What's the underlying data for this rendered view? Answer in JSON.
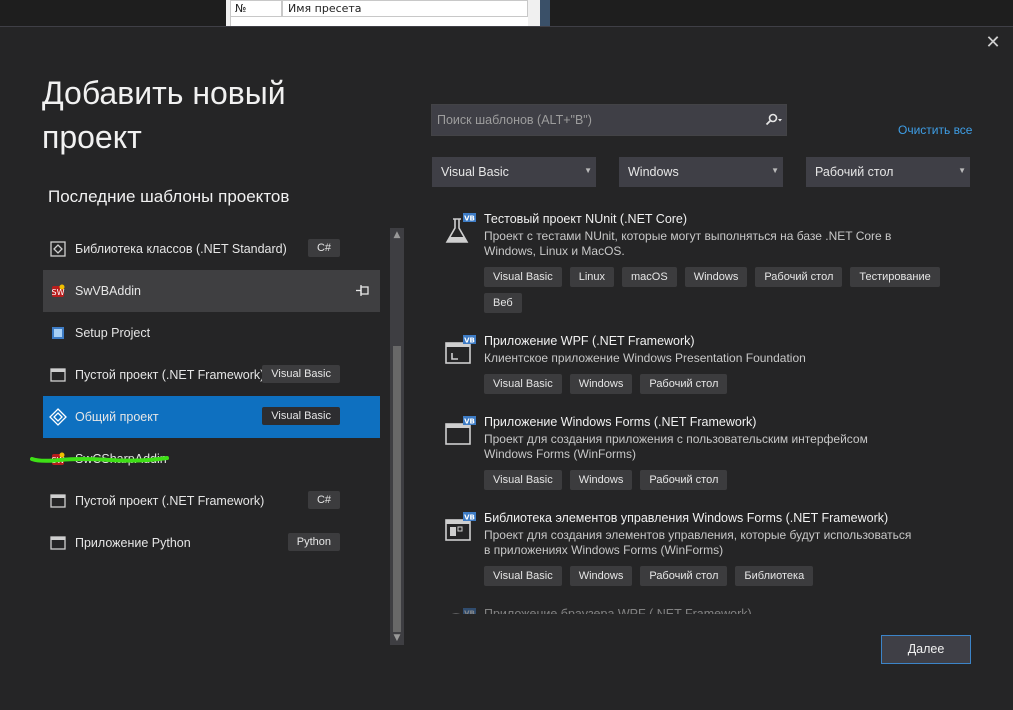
{
  "background_window": {
    "col_number": "№",
    "col_preset_name": "Имя пресета"
  },
  "dialog": {
    "title": "Добавить новый проект",
    "recent_heading": "Последние шаблоны проектов",
    "close_icon": "close-icon",
    "recent_templates": [
      {
        "label": "Библиотека классов (.NET Standard)",
        "lang": "C#",
        "icon": "class-library-icon",
        "state": "normal"
      },
      {
        "label": "SwVBAddin",
        "lang": "",
        "icon": "addin-icon",
        "state": "hover"
      },
      {
        "label": "Setup Project",
        "lang": "",
        "icon": "setup-project-icon",
        "state": "normal"
      },
      {
        "label": "Пустой проект (.NET Framework)",
        "lang": "Visual Basic",
        "icon": "empty-project-icon",
        "state": "normal"
      },
      {
        "label": "Общий проект",
        "lang": "Visual Basic",
        "icon": "shared-project-icon",
        "state": "selected"
      },
      {
        "label": "SwCSharpAddin",
        "lang": "",
        "icon": "addin-icon",
        "state": "normal"
      },
      {
        "label": "Пустой проект (.NET Framework)",
        "lang": "C#",
        "icon": "empty-project-icon",
        "state": "normal"
      },
      {
        "label": "Приложение Python",
        "lang": "Python",
        "icon": "python-app-icon",
        "state": "normal"
      }
    ],
    "search": {
      "placeholder": "Поиск шаблонов (ALT+\"В\")",
      "value": ""
    },
    "clear_all": "Очистить все",
    "filters": {
      "language": "Visual Basic",
      "platform": "Windows",
      "project_type": "Рабочий стол"
    },
    "templates": [
      {
        "title": "Тестовый проект NUnit (.NET Core)",
        "description": "Проект с тестами NUnit, которые могут выполняться на базе .NET Core в Windows, Linux и MacOS.",
        "tags": [
          "Visual Basic",
          "Linux",
          "macOS",
          "Windows",
          "Рабочий стол",
          "Тестирование",
          "Веб"
        ],
        "icon": "test-flask-icon"
      },
      {
        "title": "Приложение WPF (.NET Framework)",
        "description": "Клиентское приложение Windows Presentation Foundation",
        "tags": [
          "Visual Basic",
          "Windows",
          "Рабочий стол"
        ],
        "icon": "wpf-app-icon"
      },
      {
        "title": "Приложение Windows Forms (.NET Framework)",
        "description": "Проект для создания приложения с пользовательским интерфейсом Windows Forms (WinForms)",
        "tags": [
          "Visual Basic",
          "Windows",
          "Рабочий стол"
        ],
        "icon": "winforms-app-icon"
      },
      {
        "title": "Библиотека элементов управления Windows Forms (.NET Framework)",
        "description": "Проект для создания элементов управления, которые будут использоваться в приложениях Windows Forms (WinForms)",
        "tags": [
          "Visual Basic",
          "Windows",
          "Рабочий стол",
          "Библиотека"
        ],
        "icon": "control-library-icon"
      },
      {
        "title": "Приложение браузера WPF (.NET Framework)",
        "description": "",
        "tags": [],
        "icon": "wpf-browser-app-icon"
      }
    ],
    "next_button": "Далее"
  },
  "colors": {
    "background": "#252526",
    "selected": "#0e70c0",
    "accent_link": "#3e9ee6",
    "annotation_stroke": "#3ee016"
  }
}
